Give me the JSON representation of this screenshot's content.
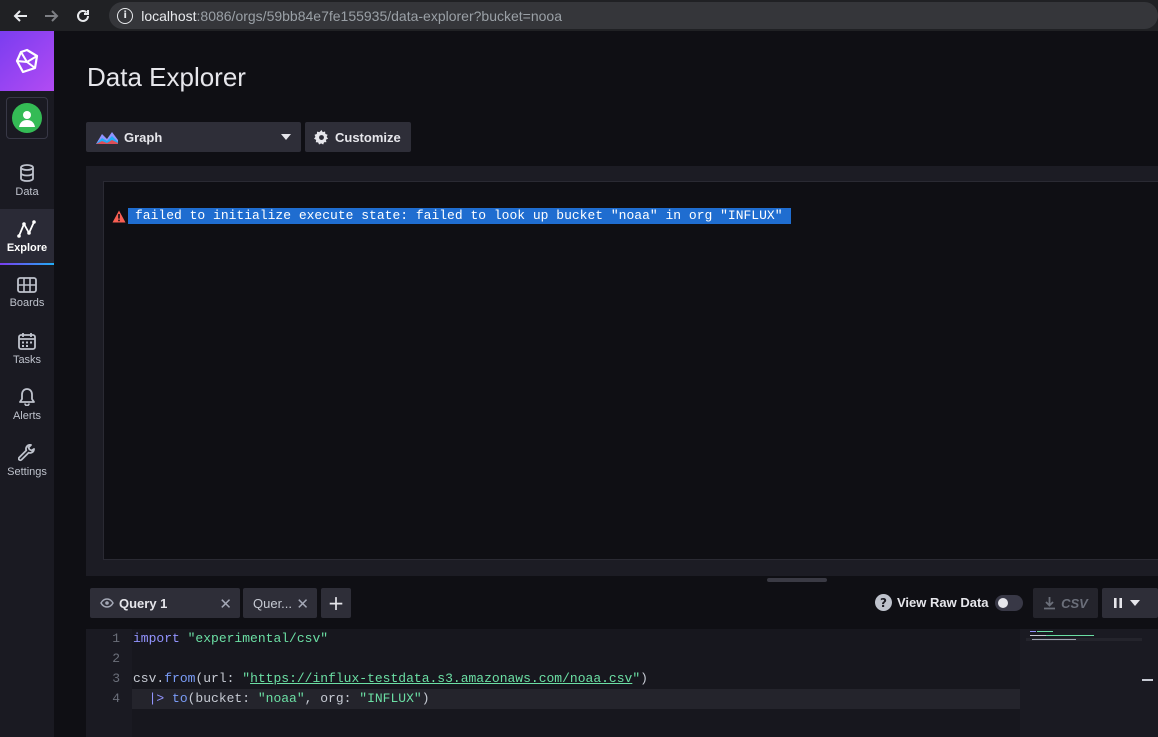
{
  "browser": {
    "url_host": "localhost",
    "url_rest": ":8086/orgs/59bb84e7fe155935/data-explorer?bucket=nooa"
  },
  "sidebar": {
    "items": [
      {
        "label": "Data",
        "icon": "database-icon"
      },
      {
        "label": "Explore",
        "icon": "explore-icon",
        "active": true
      },
      {
        "label": "Boards",
        "icon": "boards-icon"
      },
      {
        "label": "Tasks",
        "icon": "calendar-icon"
      },
      {
        "label": "Alerts",
        "icon": "bell-icon"
      },
      {
        "label": "Settings",
        "icon": "wrench-icon"
      }
    ]
  },
  "header": {
    "title": "Data Explorer"
  },
  "toolbar": {
    "graph_label": "Graph",
    "customize_label": "Customize"
  },
  "visualization": {
    "error_message": "failed to initialize execute state: failed to look up bucket \"noaa\" in org \"INFLUX\""
  },
  "query_tabs": {
    "tab1_label": "Query 1",
    "tab2_label": "Quer..."
  },
  "query_controls": {
    "help_symbol": "?",
    "view_raw_label": "View Raw Data",
    "view_raw_on": false,
    "csv_label": "CSV"
  },
  "editor": {
    "line_numbers": [
      "1",
      "2",
      "3",
      "4"
    ],
    "line1": {
      "kw": "import",
      "str": "\"experimental/csv\""
    },
    "line3": {
      "obj": "csv.",
      "fn": "from",
      "open": "(url: ",
      "q1": "\"",
      "url": "https://influx-testdata.s3.amazonaws.com/noaa.csv",
      "q2": "\"",
      "close": ")"
    },
    "line4": {
      "indent": "  ",
      "op": "|>",
      "fn": " to",
      "open": "(bucket: ",
      "bucket": "\"noaa\"",
      "mid": ", org: ",
      "org": "\"INFLUX\"",
      "close": ")"
    }
  },
  "colors": {
    "accent_purple": "#7a3df0",
    "error_highlight": "#1f6dd0",
    "code_string": "#6bdfa4",
    "code_keyword": "#9394ff"
  }
}
